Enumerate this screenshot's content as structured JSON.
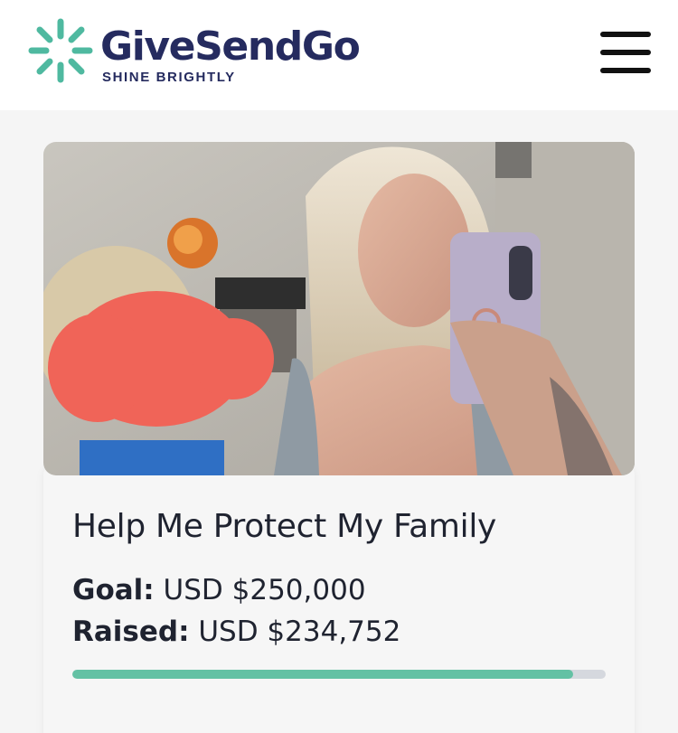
{
  "header": {
    "brand_name": "GiveSendGo",
    "tagline": "SHINE BRIGHTLY",
    "menu_icon": "hamburger-menu-icon",
    "brand_color": "#252b5f",
    "logo_accent_color": "#4fb9a0"
  },
  "campaign": {
    "image": "campaign-photo",
    "title": "Help Me Protect My Family",
    "goal_label": "Goal:",
    "goal_value": "USD $250,000",
    "raised_label": "Raised:",
    "raised_value": "USD $234,752",
    "progress_fraction": 0.939,
    "progress_color": "#64c1a4"
  }
}
